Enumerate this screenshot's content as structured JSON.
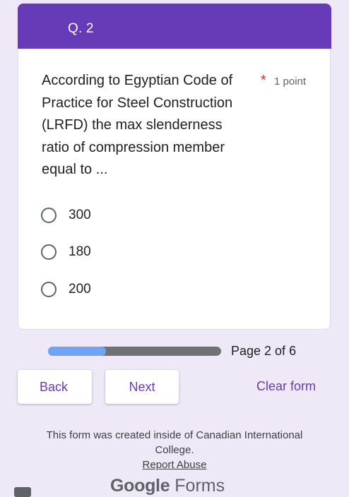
{
  "section": {
    "title": "Q. 2"
  },
  "question": {
    "text": "According to Egyptian Code of Practice for Steel Construction (LRFD) the max slenderness ratio of compression member equal to ...",
    "required_mark": "*",
    "points": "1 point",
    "options": [
      "300",
      "180",
      "200"
    ]
  },
  "progress": {
    "label": "Page 2 of 6",
    "current_page": 2,
    "total_pages": 6
  },
  "nav": {
    "back_label": "Back",
    "next_label": "Next",
    "clear_label": "Clear form"
  },
  "footer": {
    "text": "This form was created inside of Canadian International College.",
    "report_link": "Report Abuse"
  },
  "logo": {
    "google": "Google",
    "forms": "Forms"
  },
  "colors": {
    "accent": "#673ab7",
    "background": "#efe9f7",
    "progress_fill": "#6fa3f5",
    "required": "#d93025"
  },
  "icons": [
    "radio-unchecked-icon",
    "report-icon"
  ]
}
